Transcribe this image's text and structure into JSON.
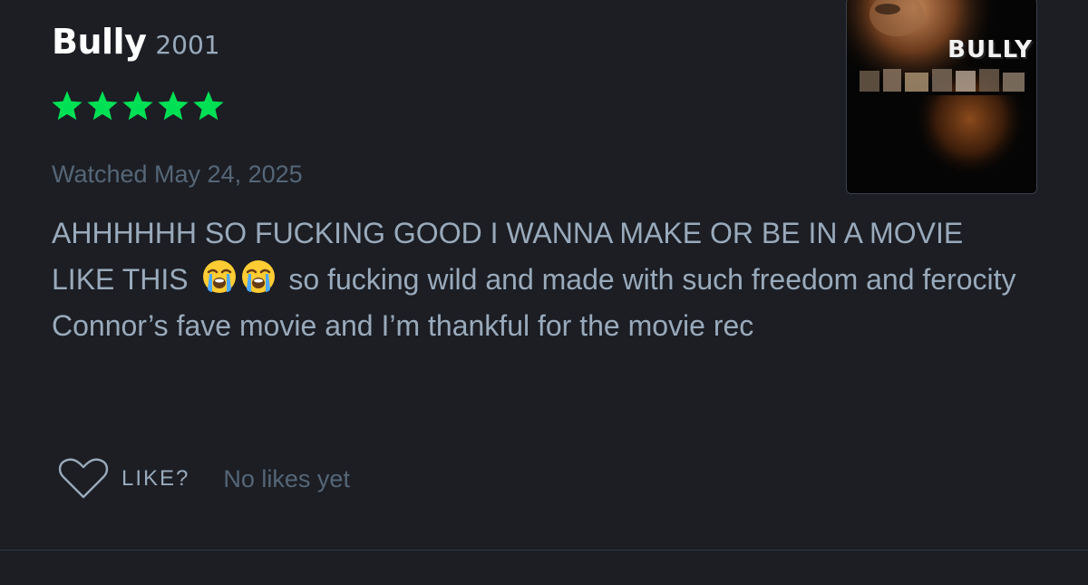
{
  "review": {
    "film_title": "Bully",
    "film_year": "2001",
    "rating": {
      "stars": 5,
      "max_stars": 5,
      "color": "#00e054"
    },
    "watched": "Watched May 24, 2025",
    "body": {
      "line1": "AHHHHHH SO FUCKING GOOD I WANNA MAKE OR BE IN A MOVIE LIKE THIS",
      "emojis": [
        "loudly-crying-face",
        "loudly-crying-face"
      ],
      "line1_tail": "so fucking wild and made with such freedom and ferocity",
      "line2": "Connor’s fave movie and I’m thankful for the movie rec"
    },
    "poster": {
      "title_text": "BULLY"
    },
    "actions": {
      "like_label": "LIKE?",
      "likes_count": "No likes yet"
    }
  },
  "colors": {
    "background": "#1c1e24",
    "title": "#ffffff",
    "body_text": "#99aabb",
    "muted_text": "#556677",
    "star_green": "#00e054"
  }
}
